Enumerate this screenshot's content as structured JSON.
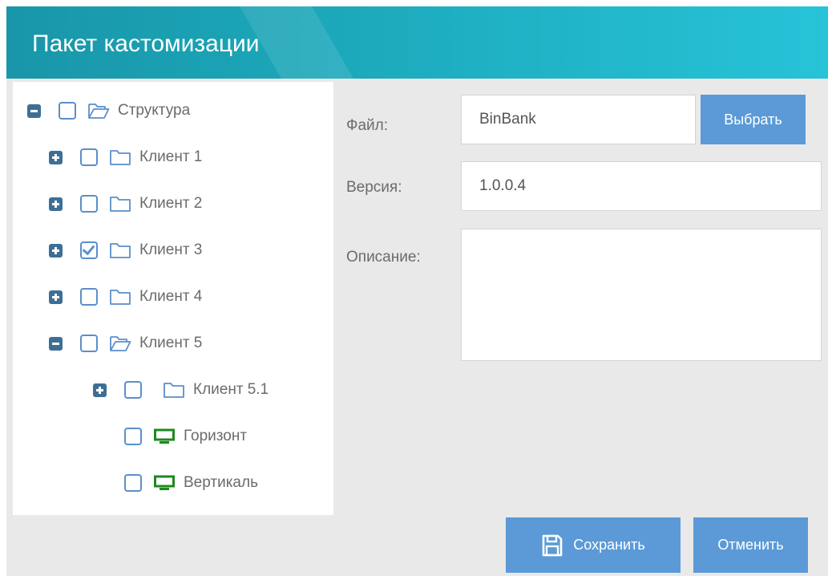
{
  "dialog": {
    "title": "Пакет кастомизации"
  },
  "tree": {
    "root": {
      "label": "Структура",
      "expanded": true,
      "checked": false,
      "icon": "folder-open-icon"
    },
    "clients": [
      {
        "label": "Клиент 1",
        "expanded": false,
        "checked": false,
        "icon": "folder-icon"
      },
      {
        "label": "Клиент 2",
        "expanded": false,
        "checked": false,
        "icon": "folder-icon"
      },
      {
        "label": "Клиент 3",
        "expanded": false,
        "checked": true,
        "icon": "folder-icon"
      },
      {
        "label": "Клиент 4",
        "expanded": false,
        "checked": false,
        "icon": "folder-icon"
      },
      {
        "label": "Клиент 5",
        "expanded": true,
        "checked": false,
        "icon": "folder-open-icon"
      }
    ],
    "sub": {
      "label": "Клиент 5.1",
      "expanded": false,
      "checked": false,
      "icon": "folder-icon"
    },
    "leaves": [
      {
        "label": "Горизонт",
        "checked": false,
        "icon": "monitor-icon"
      },
      {
        "label": "Вертикаль",
        "checked": false,
        "icon": "monitor-icon"
      }
    ]
  },
  "form": {
    "file_label": "Файл:",
    "file_value": "BinBank",
    "choose_label": "Выбрать",
    "version_label": "Версия:",
    "version_value": "1.0.0.4",
    "description_label": "Описание:",
    "description_value": ""
  },
  "actions": {
    "save_label": "Сохранить",
    "cancel_label": "Отменить"
  },
  "colors": {
    "header_start": "#1996a9",
    "header_end": "#27c3d8",
    "button": "#5b9ad6",
    "toggle": "#3d6f96",
    "checkbox": "#5b8fc9",
    "folder": "#5b8fc9",
    "monitor": "#1e8a1e"
  }
}
